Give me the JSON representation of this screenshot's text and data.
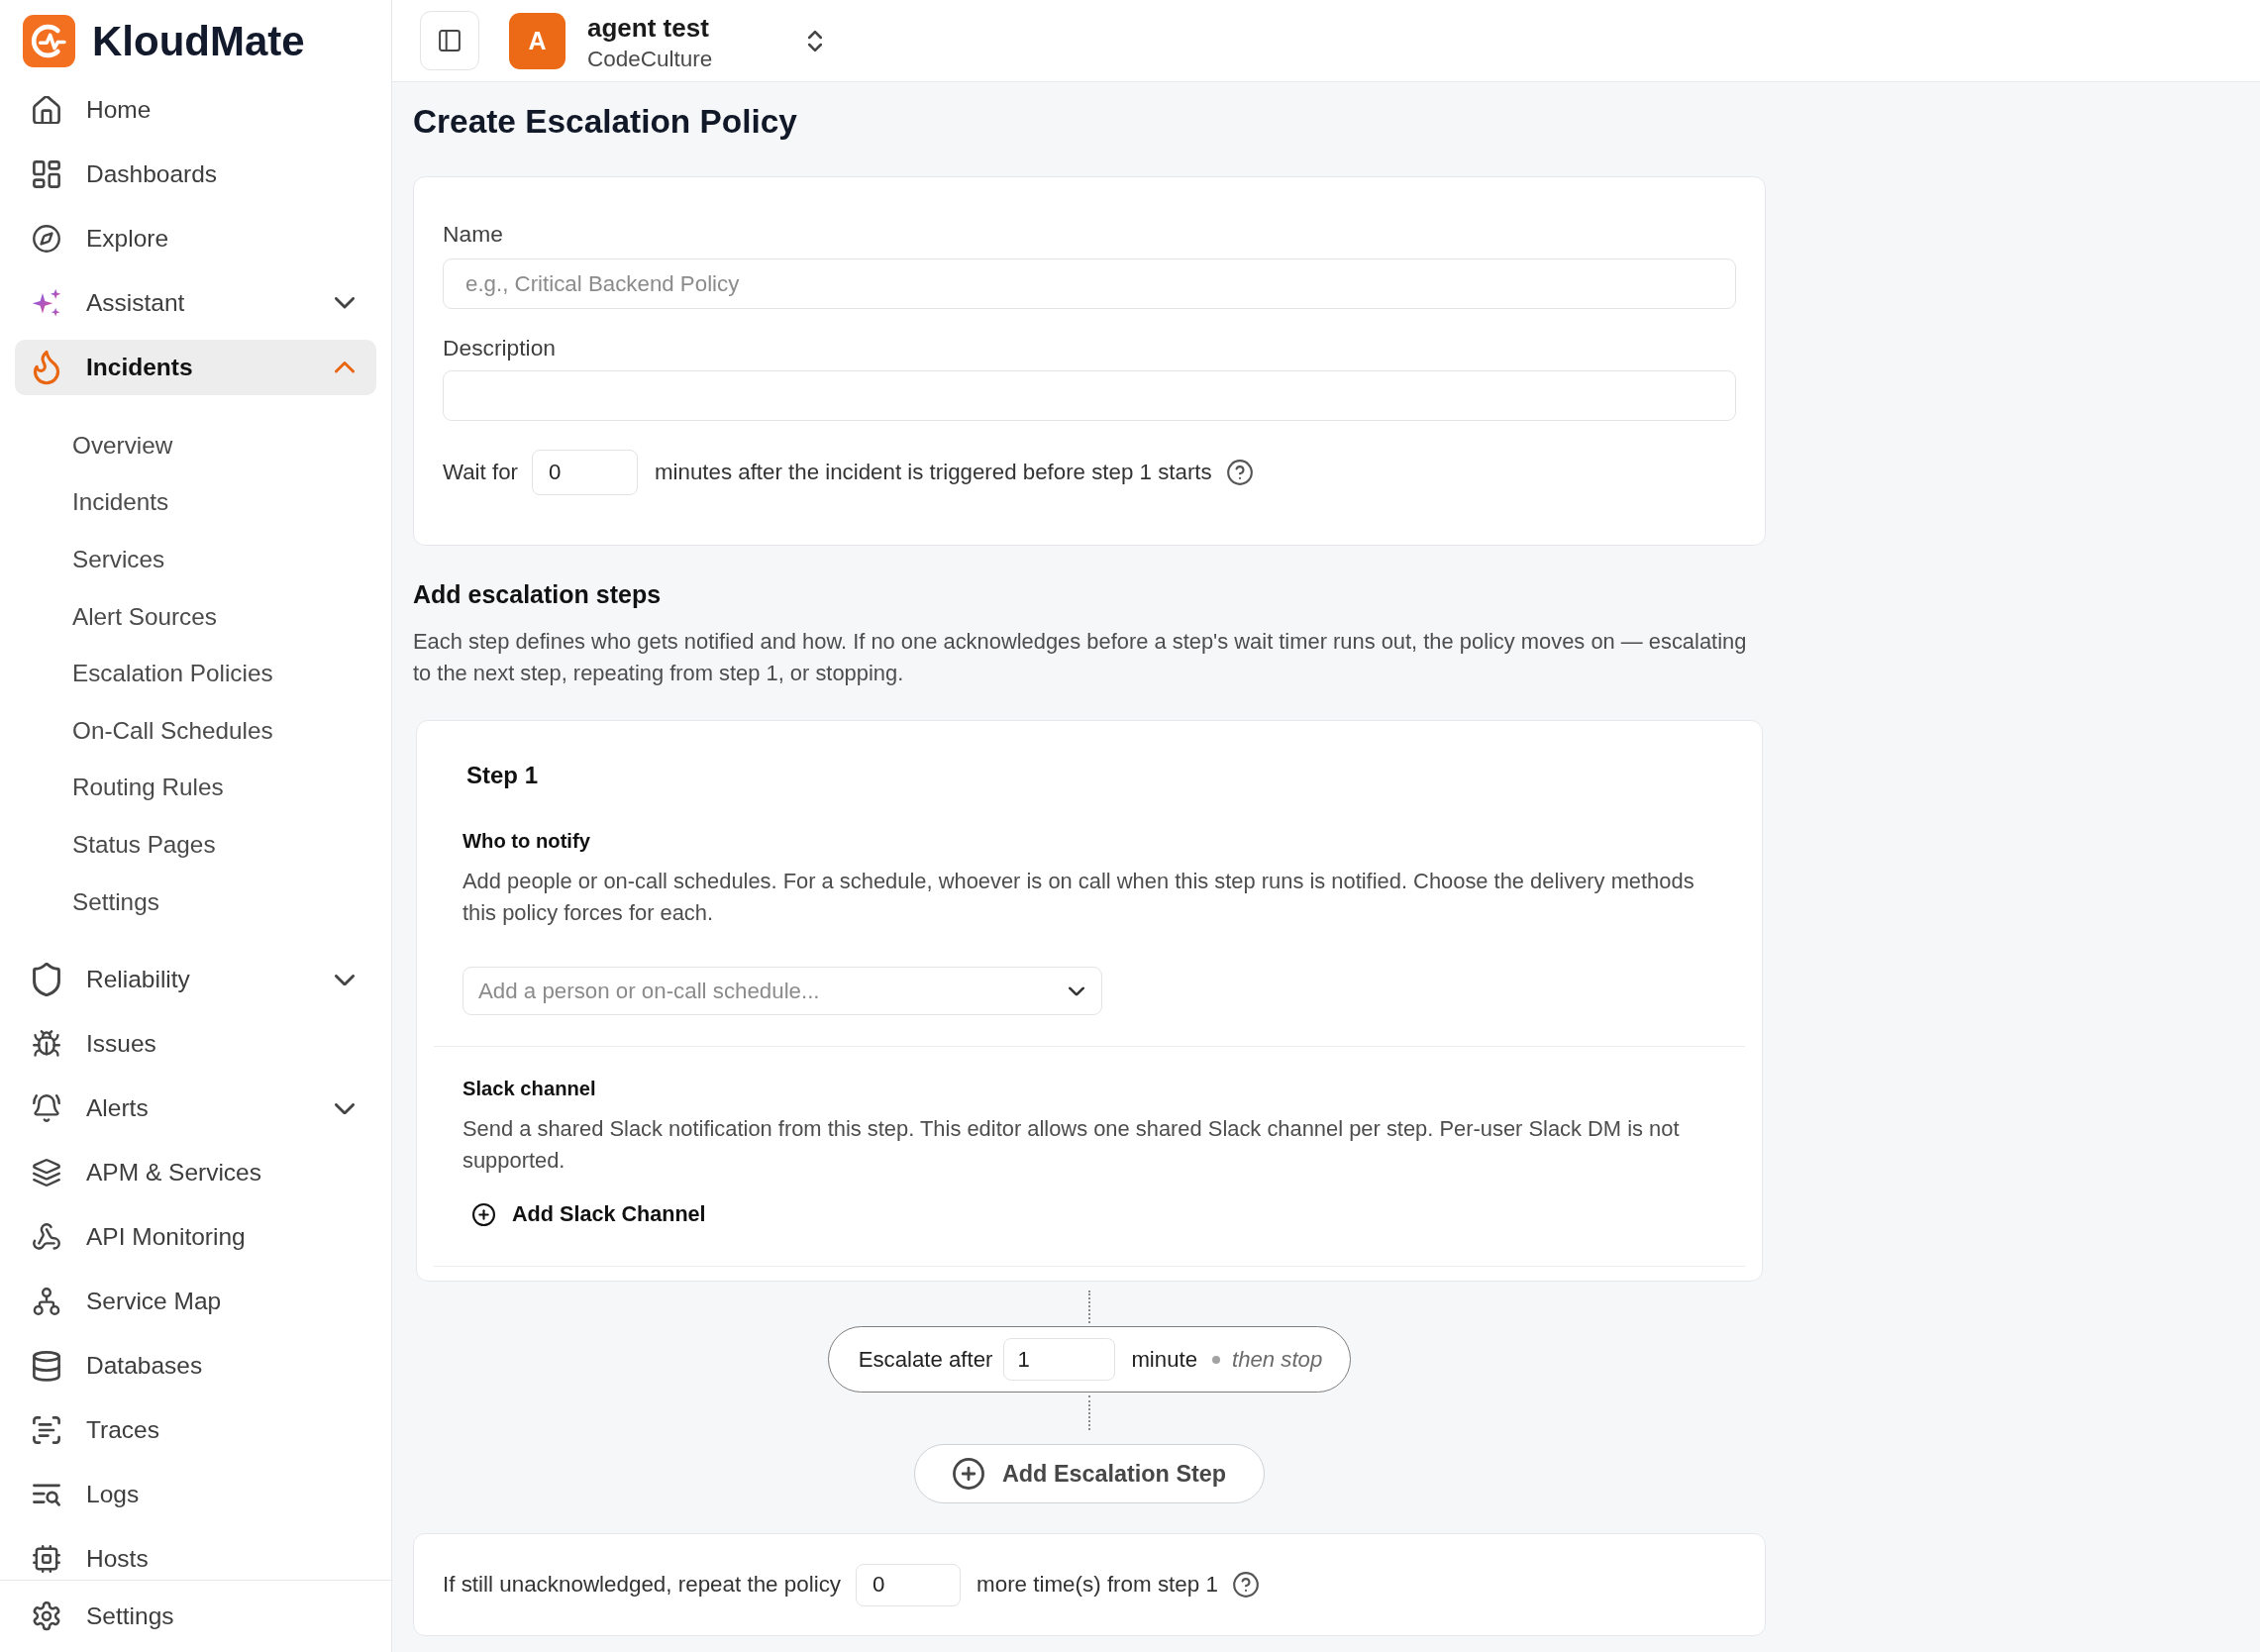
{
  "sidebar": {
    "logo": {
      "text": "KloudMate"
    },
    "items": [
      {
        "label": "Home",
        "kind": "link",
        "selected": false
      },
      {
        "label": "Dashboards",
        "kind": "link",
        "selected": false
      },
      {
        "label": "Explore",
        "kind": "link",
        "selected": false
      },
      {
        "label": "Assistant",
        "kind": "group",
        "selected": false,
        "expanded": false
      },
      {
        "label": "Incidents",
        "kind": "group",
        "selected": true,
        "expanded": true,
        "children": [
          {
            "label": "Overview",
            "selected": false
          },
          {
            "label": "Incidents",
            "selected": false
          },
          {
            "label": "Services",
            "selected": false
          },
          {
            "label": "Alert Sources",
            "selected": false
          },
          {
            "label": "Escalation Policies",
            "selected": false
          },
          {
            "label": "On-Call Schedules",
            "selected": false
          },
          {
            "label": "Routing Rules",
            "selected": false
          },
          {
            "label": "Status Pages",
            "selected": false
          },
          {
            "label": "Settings",
            "selected": false
          }
        ]
      },
      {
        "label": "Reliability",
        "kind": "group",
        "selected": false,
        "expanded": false
      },
      {
        "label": "Issues",
        "kind": "link",
        "selected": false
      },
      {
        "label": "Alerts",
        "kind": "group",
        "selected": false,
        "expanded": false
      },
      {
        "label": "APM & Services",
        "kind": "link",
        "selected": false
      },
      {
        "label": "API Monitoring",
        "kind": "link",
        "selected": false
      },
      {
        "label": "Service Map",
        "kind": "link",
        "selected": false
      },
      {
        "label": "Databases",
        "kind": "link",
        "selected": false
      },
      {
        "label": "Traces",
        "kind": "link",
        "selected": false
      },
      {
        "label": "Logs",
        "kind": "link",
        "selected": false
      },
      {
        "label": "Hosts",
        "kind": "link",
        "selected": false
      }
    ],
    "bottom_items": [
      {
        "label": "Settings",
        "kind": "link",
        "selected": false
      }
    ]
  },
  "topbar": {
    "workspace": {
      "avatar": "A",
      "name": "agent test",
      "organization": "CodeCulture"
    }
  },
  "page": {
    "title": "Create Escalation Policy"
  },
  "policy_form": {
    "name_field": {
      "label": "Name",
      "placeholder": "e.g., Critical Backend Policy"
    },
    "description_field": {
      "label": "Description"
    },
    "initial_wait": {
      "prefix": "Wait for",
      "value": "0",
      "suffix": "minutes after the incident is triggered before step 1 starts"
    }
  },
  "escalation_steps": {
    "heading": "Add escalation steps",
    "description": "Each step defines who gets notified and how. If no one acknowledges before a step's wait timer runs out, the policy moves on — escalating to the next step, repeating from step 1, or stopping.",
    "steps": [
      {
        "title": "Step 1",
        "who_to_notify": {
          "heading": "Who to notify",
          "description": "Add people or on-call schedules. For a schedule, whoever is on call when this step runs is notified. Choose the delivery methods this policy forces for each.",
          "placeholder": "Add a person or on-call schedule..."
        },
        "slack_channel": {
          "heading": "Slack channel",
          "description": "Send a shared Slack notification from this step. This editor allows one shared Slack channel per step. Per-user Slack DM is not supported.",
          "button": "Add Slack Channel"
        },
        "escalation": {
          "prefix": "Escalate after",
          "value": "1",
          "unit": "minute",
          "outcome": "then stop"
        }
      }
    ],
    "add_step_button": "Add Escalation Step"
  },
  "repeat_policy": {
    "prefix": "If still unacknowledged, repeat the policy",
    "value": "0",
    "suffix": "more time(s) from step 1"
  }
}
